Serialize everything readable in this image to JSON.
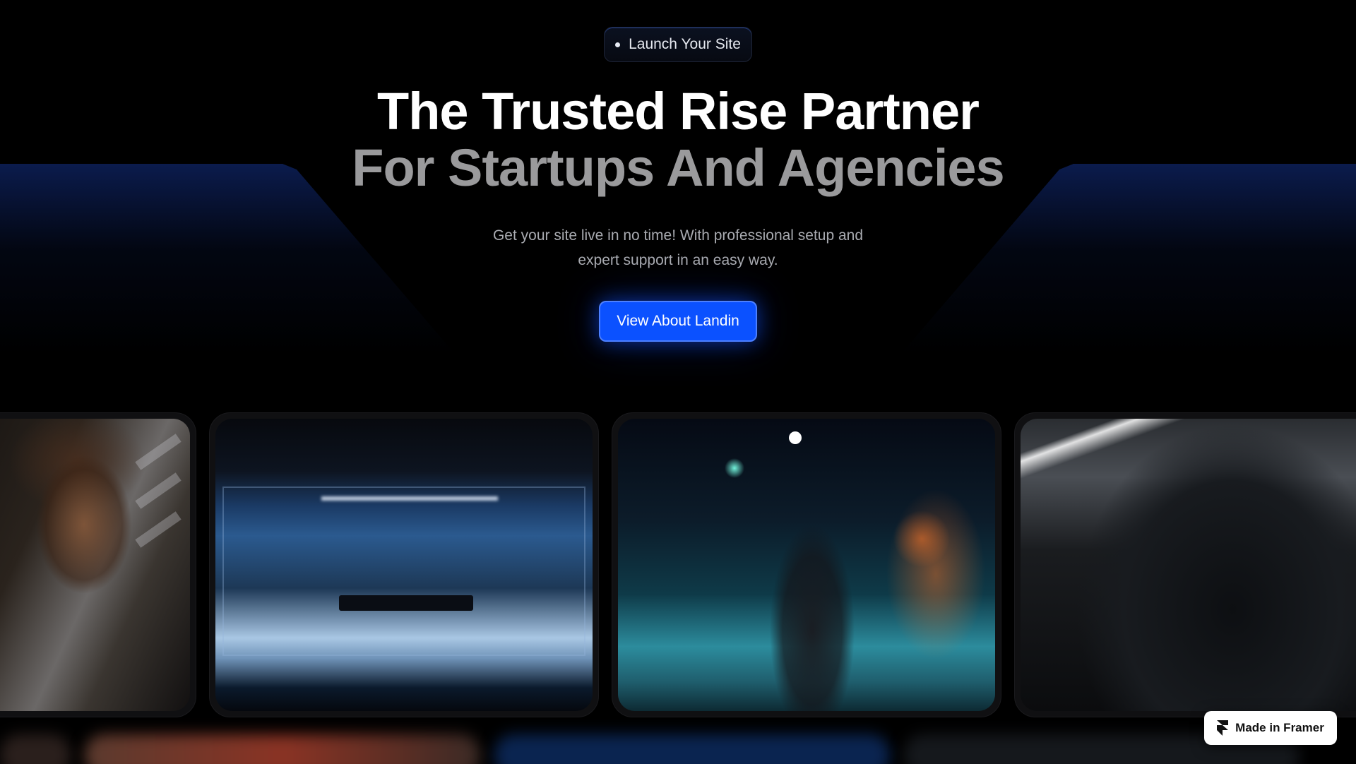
{
  "badge": {
    "label": "Launch Your Site"
  },
  "hero": {
    "title_line1": "The Trusted Rise Partner",
    "title_line2": "For Startups And Agencies",
    "subtitle_line1": "Get your site live in no time! With professional setup and",
    "subtitle_line2": "expert support in an easy way."
  },
  "cta": {
    "label": "View About Landin"
  },
  "gallery": {
    "cards": [
      {
        "name": "portrait-man-curly-hair"
      },
      {
        "name": "glass-meeting-room"
      },
      {
        "name": "man-night-street"
      },
      {
        "name": "cars-showroom"
      }
    ]
  },
  "framer_badge": {
    "label": "Made in Framer",
    "icon": "framer-logo-icon"
  },
  "colors": {
    "accent": "#0b51ff",
    "background": "#000000",
    "title_primary": "#ffffff",
    "title_secondary": "#9a9a9c"
  }
}
